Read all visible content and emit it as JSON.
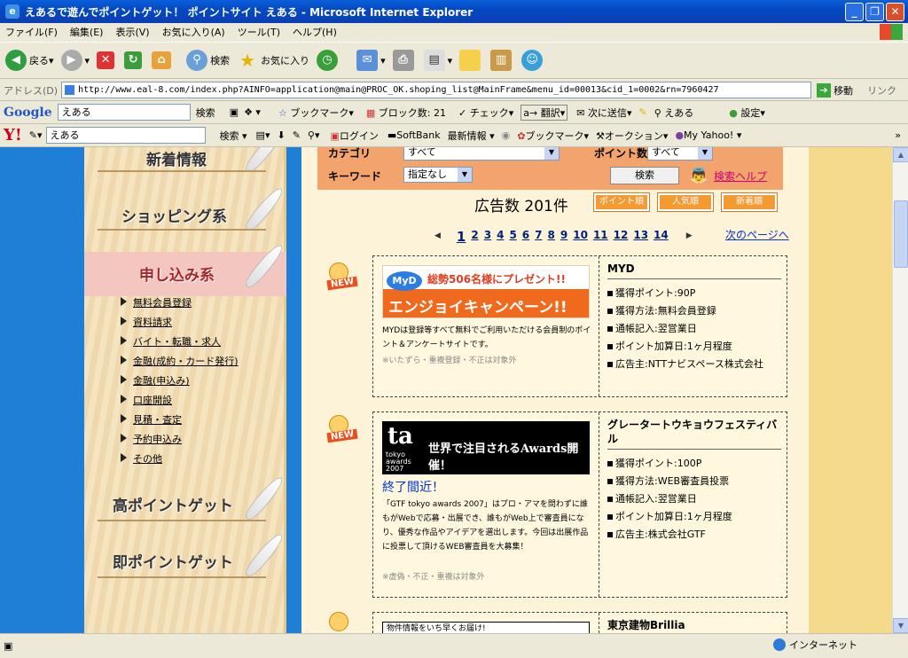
{
  "window": {
    "title": "えあるで遊んでポイントゲット！ ポイントサイト えある - Microsoft Internet Explorer",
    "min_label": "_",
    "max_label": "❐",
    "close_label": "✕"
  },
  "menu": [
    "ファイル(F)",
    "編集(E)",
    "表示(V)",
    "お気に入り(A)",
    "ツール(T)",
    "ヘルプ(H)"
  ],
  "toolbar": {
    "back_label": "戻る",
    "search_label": "検索",
    "favorites_label": "お気に入り"
  },
  "address": {
    "label": "アドレス(D)",
    "url": "http://www.eal-8.com/index.php?AINFO=application@main@PROC_OK.shoping_list@MainFrame&menu_id=00013&cid_1=0002&rn=7960427",
    "go_label": "移動",
    "links_label": "リンク"
  },
  "google_bar": {
    "logo": "Google",
    "query": "えある",
    "search_label": "検索",
    "bookmark_label": "ブックマーク",
    "popup_label": "ブロック数: 21",
    "check_label": "チェック",
    "translate_label": "翻訳",
    "send_label": "次に送信",
    "highlight_label": "えある",
    "settings_label": "設定"
  },
  "yahoo_bar": {
    "logo": "Y!",
    "query": "えある",
    "search_label": "検索",
    "login_label": "ログイン",
    "softbank_label": "SoftBank",
    "news_label": "最新情報",
    "bookmark_label": "ブックマーク",
    "auction_label": "オークション",
    "myyahoo_label": "My Yahoo!"
  },
  "sidebar": {
    "heading_new": "新着情報",
    "heading_shopping": "ショッピング系",
    "heading_apply": "申し込み系",
    "items": [
      "無料会員登録",
      "資料請求",
      "バイト・転職・求人",
      "金融(成約・カード発行)",
      "金融(申込み)",
      "口座開設",
      "見積・査定",
      "予約申込み",
      "その他"
    ],
    "heading_high": "高ポイントゲット",
    "heading_instant": "即ポイントゲット"
  },
  "search": {
    "category_label": "カテゴリ",
    "category_value": "すべて",
    "points_label": "ポイント数",
    "points_value": "すべて",
    "keyword_label": "キーワード",
    "keyword_value": "指定なし",
    "button_label": "検索",
    "help_label": "検索ヘルプ"
  },
  "results": {
    "count_label": "広告数 201件",
    "sort": [
      "ポイント順",
      "人気順",
      "新着順"
    ],
    "pages": [
      "1",
      "2",
      "3",
      "4",
      "5",
      "6",
      "7",
      "8",
      "9",
      "10",
      "11",
      "12",
      "13",
      "14"
    ],
    "prev_label": "◀",
    "next_arrow": "▶",
    "next_label": "次のページへ"
  },
  "ads": [
    {
      "new_label": "NEW",
      "banner_line1": "総勢506名様にプレゼント!!",
      "banner_line2": "エンジョイキャンペーン!!",
      "banner_logo": "MyD",
      "desc": "MYDは登録等すべて無料でご利用いただける会員制のポイント＆アンケートサイトです。",
      "note": "※いたずら・重複登録・不正は対象外",
      "name": "MYD",
      "points": "獲得ポイント:90P",
      "method": "獲得方法:無料会員登録",
      "passbook": "通帳記入:翌営業日",
      "timing": "ポイント加算日:1ヶ月程度",
      "advertiser": "広告主:NTTナビスペース株式会社"
    },
    {
      "new_label": "NEW",
      "banner_logo": "ta",
      "banner_sub": "tokyo awards 2007",
      "banner_text": "世界で注目されるAwards開催！",
      "ended": "終了間近！",
      "desc": "「GTF tokyo awards 2007」はプロ・アマを問わずに誰もがWebで応募・出展でき、誰もがWeb上で審査員になり、優秀な作品やアイデアを選出します。今回は出展作品に投票して頂けるWEB審査員を大募集！",
      "note": "※虚偽・不正・重複は対象外",
      "name": "グレータートウキョウフェスティバル",
      "points": "獲得ポイント:100P",
      "method": "獲得方法:WEB審査員投票",
      "passbook": "通帳記入:翌営業日",
      "timing": "ポイント加算日:1ヶ月程度",
      "advertiser": "広告主:株式会社GTF"
    },
    {
      "banner_text": "物件情報をいち早くお届け!",
      "name": "東京建物Brillia"
    }
  ],
  "status": {
    "zone": "インターネット"
  },
  "colors": {
    "ie_blue": "#0549c5",
    "page_blue": "#1f7fd6",
    "search_orange": "#f2a46c",
    "sort_orange": "#f39a33"
  }
}
